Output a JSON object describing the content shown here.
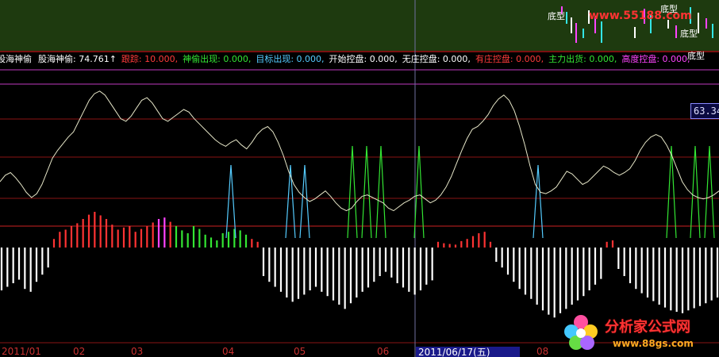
{
  "header": {
    "indicator_name": "股海神偷",
    "items": [
      {
        "label": "股海神偷: 74.761↑",
        "color": "#ffffff"
      },
      {
        "label": "跟踪: 10.000,",
        "color": "#ff3b3b"
      },
      {
        "label": "神偷出现: 0.000,",
        "color": "#33e633"
      },
      {
        "label": "目标出现: 0.000,",
        "color": "#55ccff"
      },
      {
        "label": "开始控盘: 0.000,",
        "color": "#ffffff"
      },
      {
        "label": "无庄控盘: 0.000,",
        "color": "#ffffff"
      },
      {
        "label": "有庄控盘: 0.000,",
        "color": "#ff3b3b"
      },
      {
        "label": "主力出货: 0.000,",
        "color": "#33e633"
      },
      {
        "label": "高度控盘: 0.000,",
        "color": "#ff44ff"
      }
    ]
  },
  "top_panel": {
    "labels": [
      "底型",
      "底型",
      "底型",
      "底型"
    ],
    "url_text": "www.55188.com"
  },
  "price_tag": "63.34",
  "cursor_date": "2011/06/17(五)",
  "x_axis_labels": [
    {
      "text": "2011/01",
      "pos": "start"
    },
    {
      "text": "02"
    },
    {
      "text": "03"
    },
    {
      "text": "04"
    },
    {
      "text": "05"
    },
    {
      "text": "06"
    },
    {
      "text": "08"
    }
  ],
  "watermark": {
    "title": "分析家公式网",
    "url": "www.88gs.com"
  },
  "colors": {
    "up_bar": "#ff3333",
    "down_bar": "#ffffff",
    "green_bar": "#33e633",
    "magenta_bar": "#ff44ff",
    "line": "#e6e6c8",
    "cyan_spike": "#55ccff",
    "green_spike": "#33e633",
    "grid_red": "#8a1515",
    "level_magenta": "#c03ac0"
  },
  "chart_data": {
    "type": "line",
    "title": "",
    "xlabel": "",
    "ylabel": "",
    "series": [
      {
        "name": "股海神偷",
        "values": [
          50,
          55,
          57,
          53,
          48,
          42,
          38,
          41,
          48,
          58,
          68,
          74,
          79,
          84,
          88,
          96,
          104,
          112,
          117,
          119,
          116,
          110,
          104,
          98,
          96,
          100,
          106,
          112,
          114,
          110,
          104,
          98,
          96,
          99,
          102,
          105,
          103,
          98,
          94,
          90,
          86,
          82,
          79,
          77,
          80,
          82,
          78,
          75,
          80,
          86,
          90,
          92,
          88,
          80,
          70,
          58,
          48,
          42,
          38,
          35,
          37,
          40,
          43,
          39,
          34,
          30,
          28,
          30,
          35,
          39,
          40,
          38,
          36,
          34,
          30,
          28,
          31,
          34,
          36,
          39,
          40,
          37,
          34,
          36,
          40,
          46,
          54,
          64,
          74,
          83,
          90,
          92,
          96,
          101,
          108,
          113,
          116,
          112,
          104,
          92,
          78,
          62,
          48,
          42,
          41,
          43,
          46,
          52,
          58,
          56,
          52,
          48,
          50,
          54,
          58,
          62,
          60,
          57,
          55,
          57,
          60,
          66,
          74,
          80,
          84,
          86,
          84,
          78,
          70,
          60,
          50,
          44,
          40,
          38,
          37,
          38,
          40,
          43
        ],
        "y_range": [
          0,
          140
        ]
      }
    ],
    "histogram": {
      "values": [
        -60,
        -55,
        -50,
        -45,
        -58,
        -62,
        -48,
        -38,
        -28,
        12,
        22,
        25,
        30,
        34,
        40,
        46,
        50,
        45,
        40,
        32,
        25,
        28,
        30,
        22,
        26,
        30,
        35,
        40,
        42,
        36,
        30,
        24,
        20,
        30,
        26,
        18,
        14,
        10,
        20,
        22,
        26,
        24,
        18,
        12,
        8,
        -40,
        -48,
        -55,
        -62,
        -70,
        -76,
        -72,
        -66,
        -60,
        -55,
        -62,
        -68,
        -74,
        -80,
        -86,
        -78,
        -70,
        -62,
        -56,
        -48,
        -40,
        -34,
        -42,
        -50,
        -56,
        -62,
        -66,
        -60,
        -52,
        -46,
        8,
        6,
        5,
        4,
        9,
        12,
        16,
        20,
        22,
        8,
        -20,
        -28,
        -38,
        -48,
        -58,
        -66,
        -72,
        -80,
        -88,
        -94,
        -98,
        -92,
        -86,
        -80,
        -74,
        -68,
        -60,
        -52,
        -44,
        8,
        10,
        -30,
        -40,
        -50,
        -58,
        -64,
        -70,
        -75,
        -80,
        -84,
        -88,
        -90,
        -92,
        -88,
        -85,
        -82,
        -78,
        -74,
        -70
      ],
      "y_range": [
        -100,
        80
      ]
    },
    "spikes": [
      {
        "x": 97,
        "color": "cyan"
      },
      {
        "x": 122,
        "color": "cyan"
      },
      {
        "x": 128,
        "color": "cyan"
      },
      {
        "x": 148,
        "color": "green"
      },
      {
        "x": 154,
        "color": "green"
      },
      {
        "x": 160,
        "color": "green"
      },
      {
        "x": 176,
        "color": "green"
      },
      {
        "x": 226,
        "color": "cyan"
      },
      {
        "x": 282,
        "color": "green"
      },
      {
        "x": 292,
        "color": "green"
      },
      {
        "x": 298,
        "color": "green"
      }
    ]
  }
}
